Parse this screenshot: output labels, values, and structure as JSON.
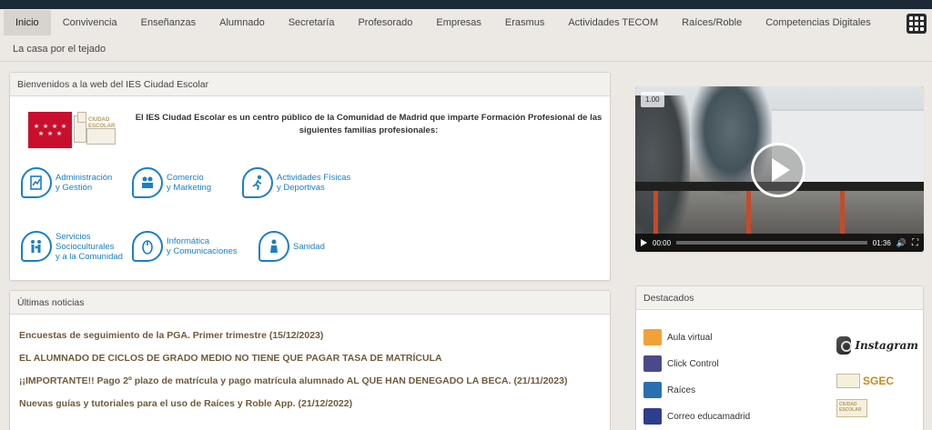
{
  "nav": {
    "row1": [
      "Inicio",
      "Convivencia",
      "Enseñanzas",
      "Alumnado",
      "Secretaría",
      "Profesorado",
      "Empresas",
      "Erasmus",
      "Actividades TECOM",
      "Raíces/Roble",
      "Competencias Digitales"
    ],
    "row2": [
      "La casa por el tejado"
    ],
    "active": "Inicio"
  },
  "welcome": {
    "header": "Bienvenidos a la web del IES Ciudad Escolar",
    "logo_text": "CIUDAD ESCOLAR",
    "intro": "El IES Ciudad Escolar es un centro público de la Comunidad de Madrid que imparte Formación Profesional de las siguientes familias profesionales:",
    "families": [
      {
        "label1": "Administración",
        "label2": "y Gestión",
        "label3": "",
        "icon": "document-chart-icon"
      },
      {
        "label1": "Comercio",
        "label2": "y Marketing",
        "label3": "",
        "icon": "people-cart-icon"
      },
      {
        "label1": "Actividades Físicas",
        "label2": "y Deportivas",
        "label3": "",
        "icon": "runner-icon"
      },
      {
        "label1": "Servicios",
        "label2": "Socioculturales",
        "label3": "y a la Comunidad",
        "icon": "family-icon"
      },
      {
        "label1": "Informática",
        "label2": "y Comunicaciones",
        "label3": "",
        "icon": "computer-mouse-icon"
      },
      {
        "label1": "Sanidad",
        "label2": "",
        "label3": "",
        "icon": "nurse-icon"
      }
    ]
  },
  "news": {
    "header": "Últimas noticias",
    "items": [
      "Encuestas de seguimiento de la PGA. Primer trimestre (15/12/2023)",
      "EL ALUMNADO DE CICLOS DE GRADO MEDIO NO TIENE QUE PAGAR TASA DE MATRÍCULA",
      "¡¡IMPORTANTE!! Pago 2º plazo de matrícula y pago matrícula alumnado AL QUE HAN DENEGADO LA BECA. (21/11/2023)",
      "Nuevas guías y tutoriales para el uso de Raíces y Roble App. (21/12/2022)"
    ]
  },
  "video": {
    "badge": "1.00",
    "current_time": "00:00",
    "duration": "01:36",
    "progress": 0.0
  },
  "featured": {
    "header": "Destacados",
    "links": [
      {
        "label": "Aula virtual",
        "icon": "moodle-icon",
        "color": "#f0a23a"
      },
      {
        "label": "Click Control",
        "icon": "click-control-icon",
        "color": "#4a4a8a"
      },
      {
        "label": "Raíces",
        "icon": "raices-icon",
        "color": "#2a6fb0"
      },
      {
        "label": "Correo educamadrid",
        "icon": "mail-icon",
        "color": "#2c3e8c"
      }
    ],
    "instagram": "Instagram",
    "sgec": "SGEC",
    "ce_logo": "CIUDAD ESCOLAR"
  }
}
